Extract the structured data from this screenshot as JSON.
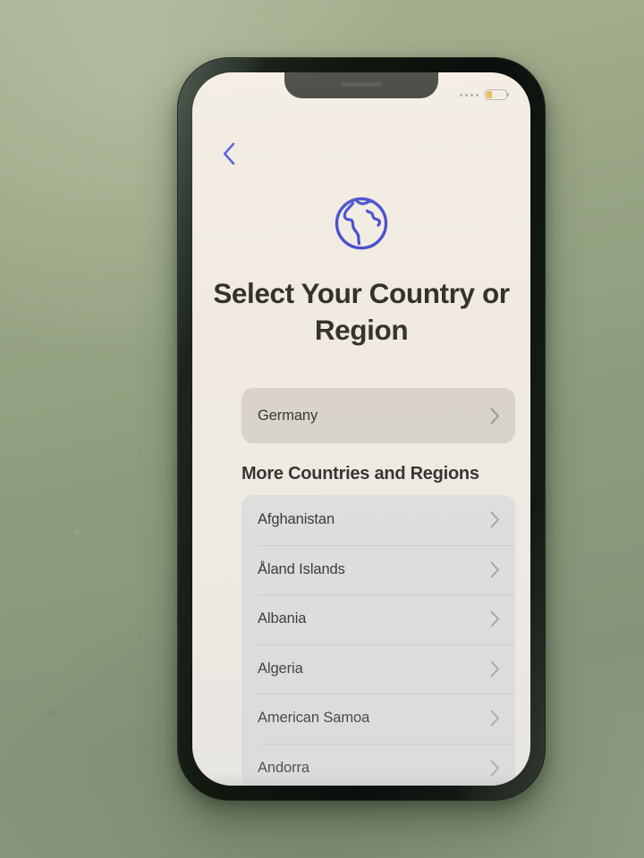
{
  "device": {
    "statusbar": {
      "signal_dots": 4,
      "battery_level_percent": 26,
      "battery_color": "#E8A81D"
    }
  },
  "screen": {
    "background_color": "#EFE9E0",
    "accent_color": "#2A35C8",
    "nav": {
      "back_label": "Back",
      "back_icon": "chevron-left-icon"
    },
    "hero_icon": "globe-icon",
    "title": "Select Your Country or Region",
    "selected_country": {
      "label": "Germany",
      "chevron_icon": "chevron-right-icon"
    },
    "section_header": "More Countries and Regions",
    "countries": [
      {
        "label": "Afghanistan",
        "chevron_icon": "chevron-right-icon"
      },
      {
        "label": "Åland Islands",
        "chevron_icon": "chevron-right-icon"
      },
      {
        "label": "Albania",
        "chevron_icon": "chevron-right-icon"
      },
      {
        "label": "Algeria",
        "chevron_icon": "chevron-right-icon"
      },
      {
        "label": "American Samoa",
        "chevron_icon": "chevron-right-icon"
      },
      {
        "label": "Andorra",
        "chevron_icon": "chevron-right-icon"
      }
    ]
  }
}
